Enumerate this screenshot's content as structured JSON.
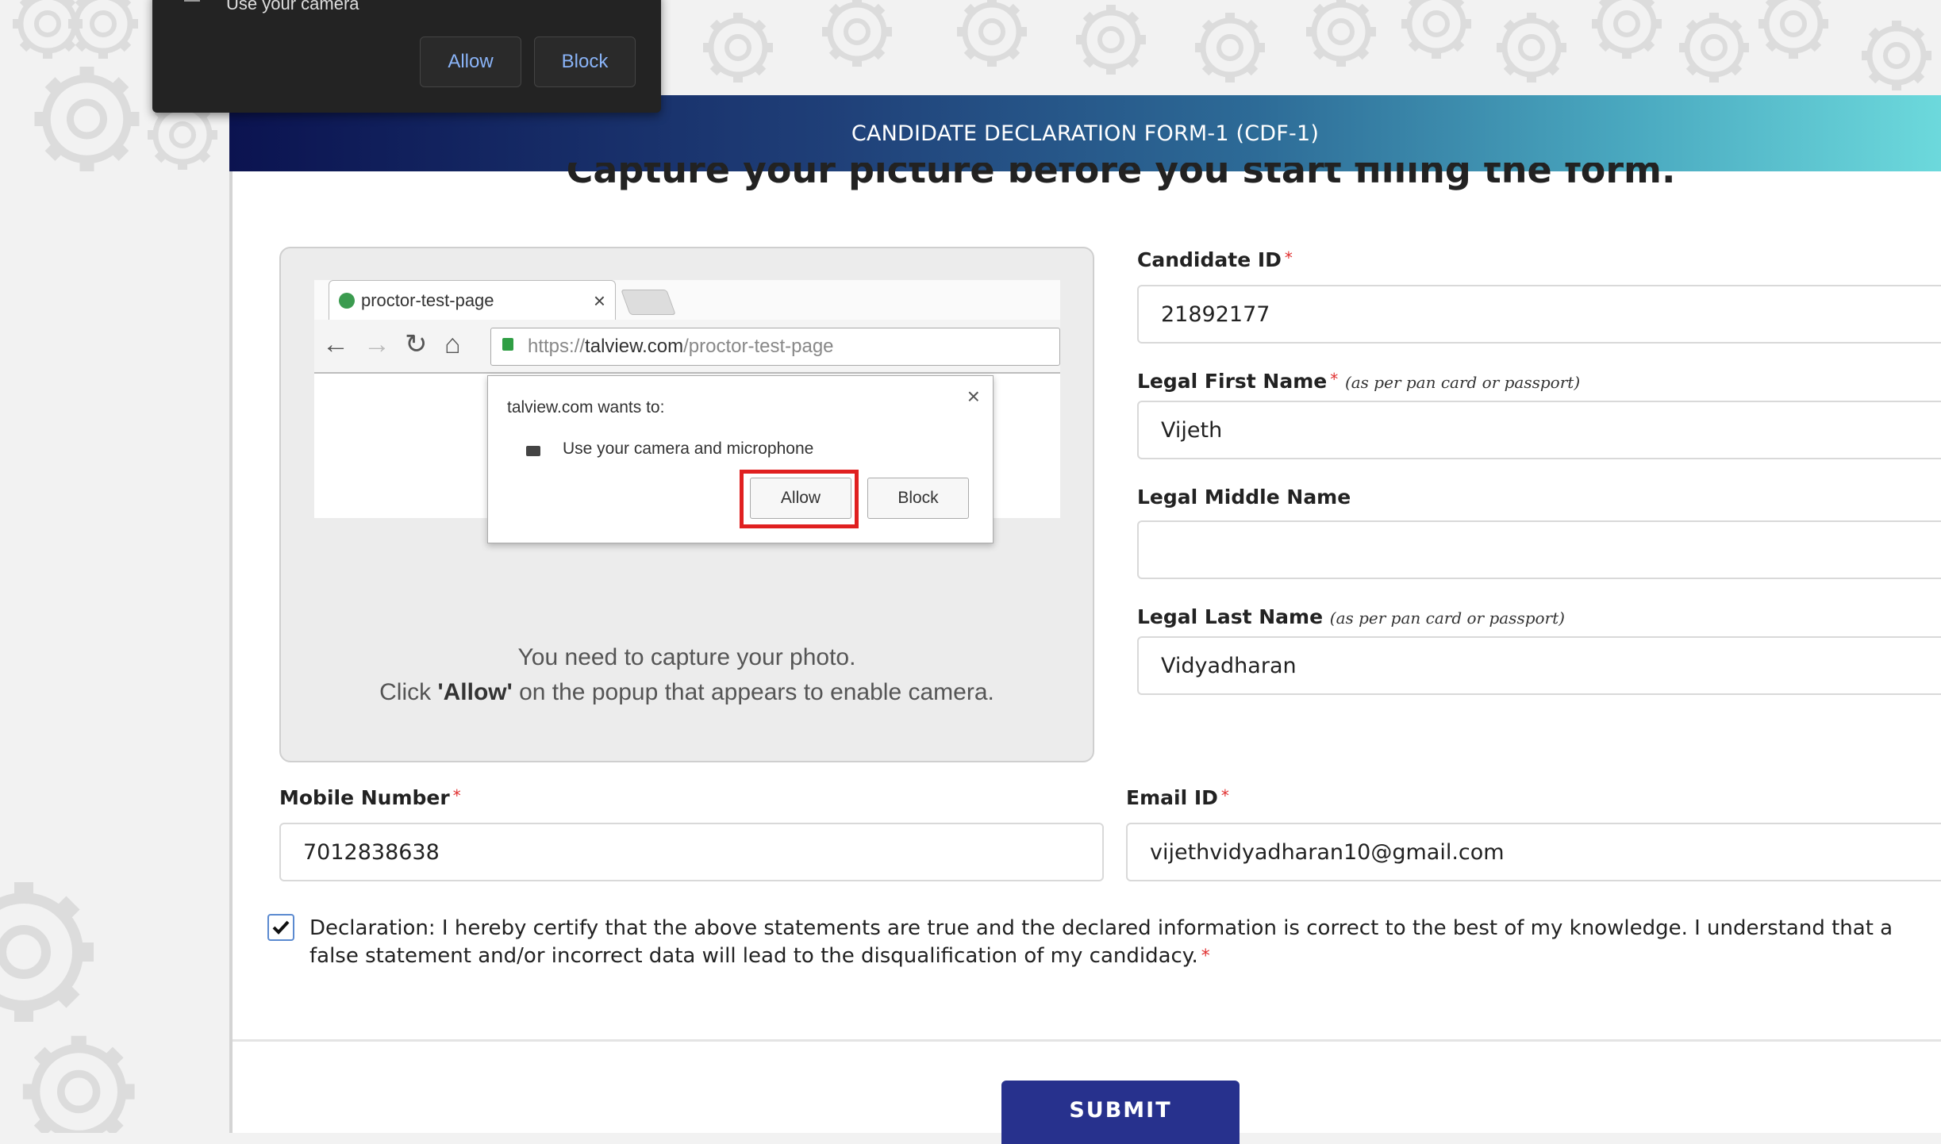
{
  "browser_permission": {
    "prompt_text": "Use your camera",
    "allow_label": "Allow",
    "block_label": "Block"
  },
  "form": {
    "header_title": "CANDIDATE DECLARATION FORM-1 (CDF-1)",
    "capture_heading": "Capture your picture before you start filling the form.",
    "illustration": {
      "tab_title": "proctor-test-page",
      "url_scheme": "https://",
      "url_host": "talview.com",
      "url_path": "/proctor-test-page",
      "dialog_title": "talview.com wants to:",
      "dialog_permission": "Use your camera and microphone",
      "dialog_allow": "Allow",
      "dialog_block": "Block"
    },
    "photo_instruction_line1": "You need to capture your photo.",
    "photo_instruction_prefix": "Click ",
    "photo_instruction_bold": "'Allow'",
    "photo_instruction_suffix": " on the popup that appears to enable camera.",
    "required_mark": "*",
    "candidate_id": {
      "label": "Candidate ID",
      "value": "21892177"
    },
    "first_name": {
      "label": "Legal First Name",
      "hint": "(as per pan card or passport)",
      "value": "Vijeth"
    },
    "middle_name": {
      "label": "Legal Middle Name",
      "value": ""
    },
    "last_name": {
      "label": "Legal Last Name",
      "hint": "(as per pan card or passport)",
      "value": "Vidyadharan"
    },
    "mobile": {
      "label": "Mobile Number",
      "value": "7012838638"
    },
    "email": {
      "label": "Email ID",
      "value": "vijethvidyadharan10@gmail.com"
    },
    "declaration": {
      "checked": true,
      "text": "Declaration: I hereby certify that the above statements are true and the declared information is correct to the best of my knowledge. I understand that a false statement and/or incorrect data will lead to the disqualification of my candidacy."
    },
    "submit_label": "SUBMIT"
  },
  "colors": {
    "header_gradient_start": "#0b1350",
    "header_gradient_end": "#6cd9dc",
    "submit_bg": "#27318d",
    "required": "#e03030",
    "highlight": "#e02020"
  },
  "icons": {
    "tab_favicon": "leaf-icon",
    "nav": [
      "back-arrow-icon",
      "forward-arrow-icon",
      "reload-icon",
      "home-icon"
    ],
    "omnibox": "lock-icon",
    "permission": "camera-icon",
    "checkbox": "checkmark-icon",
    "background": "gear-icon"
  }
}
